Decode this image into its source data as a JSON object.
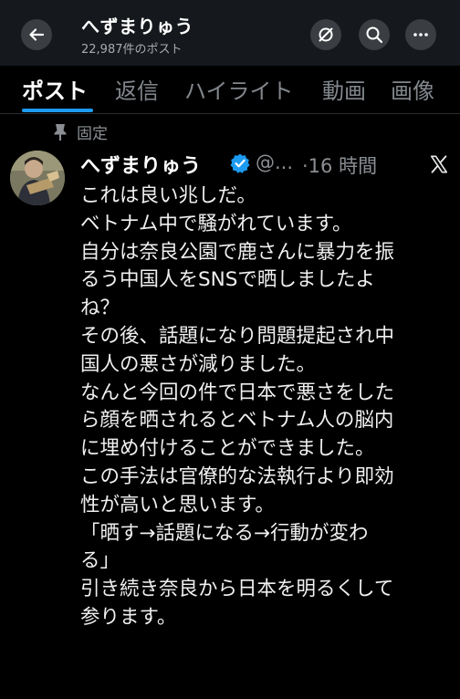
{
  "header": {
    "display_name": "へずまりゅう",
    "post_count": "22,987件のポスト",
    "back_icon": "arrow-left-icon",
    "action_icons": [
      "filter-icon",
      "search-icon",
      "more-icon"
    ]
  },
  "tabs": [
    {
      "label": "ポスト",
      "active": true
    },
    {
      "label": "返信",
      "active": false
    },
    {
      "label": "ハイライト",
      "active": false
    },
    {
      "label": "動画",
      "active": false
    },
    {
      "label": "画像",
      "active": false
    }
  ],
  "pinned": {
    "label": "固定",
    "icon": "pin-icon"
  },
  "post": {
    "author_name": "へずまりゅう",
    "verified": true,
    "handle": "@...",
    "time": "·16 時間",
    "platform_icon": "x-logo-icon",
    "lines": [
      "これは良い兆しだ。",
      "ベトナム中で騒がれています。",
      "自分は奈良公園で鹿さんに暴力を振",
      "るう中国人をSNSで晒しましたよ",
      "ね？",
      "その後、話題になり問題提起され中",
      "国人の悪さが減りました。",
      "なんと今回の件で日本で悪さをした",
      "ら顔を晒されるとベトナム人の脳内",
      "に埋め付けることができました。",
      "この手法は官僚的な法執行より即効",
      "性が高いと思います。",
      "「晒す→話題になる→行動が変わ",
      "る」",
      "引き続き奈良から日本を明るくして",
      "参ります。"
    ]
  },
  "colors": {
    "background": "#000000",
    "header_bg": "#15181c",
    "accent": "#1d9bf0",
    "muted_text": "#8b8f94",
    "text": "#f0f0f0"
  }
}
